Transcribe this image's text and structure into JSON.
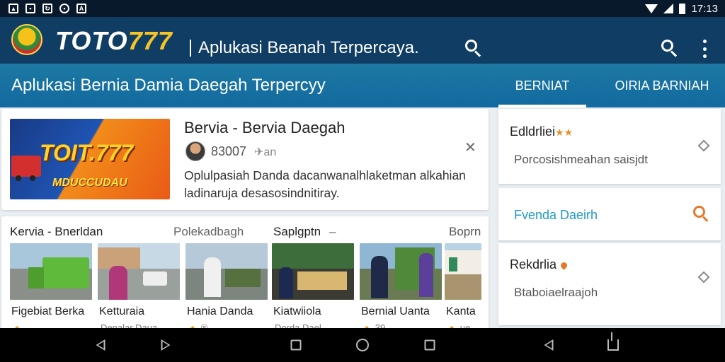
{
  "status_bar": {
    "time": "17:13",
    "left_icons": [
      "image-icon",
      "photo-icon",
      "sync-icon",
      "alarm-icon",
      "text-icon"
    ]
  },
  "app_bar": {
    "brand_prefix": "TOTO",
    "brand_number": "777",
    "subtitle": "Aplukasi Beanah Terpercaya."
  },
  "tab_bar": {
    "title": "Aplukasi Bernia Damia Daegah Terpercyy",
    "tabs": [
      {
        "label": "BERNIAT",
        "active": true
      },
      {
        "label": "OIRIA BARNIAH",
        "active": false
      }
    ]
  },
  "feature": {
    "banner_title": "TOIT.777",
    "banner_sub": "MDUCCUDAU",
    "title": "Bervia - Bervia Daegah",
    "meta": "83007",
    "meta_suffix": "✈an",
    "description": "Oplulpasiah Danda dacanwanalhlaketman alkahian ladinaruja desasosindnitiray."
  },
  "list": {
    "headers": [
      "Kervia - Bnerldan",
      "Polekadbagh",
      "Saplgptn",
      "Boprn"
    ],
    "dash": "–",
    "items": [
      {
        "caption": "Figebiat Berka",
        "sub": "🔸"
      },
      {
        "caption": "Ketturaia",
        "sub": "Denalar Daua"
      },
      {
        "caption": "Hania Danda",
        "sub": "🔸 ®"
      },
      {
        "caption": "Kiatwiiola",
        "sub": "Dorda Dael"
      },
      {
        "caption": "Bernial Uanta",
        "sub": "🔸 39"
      },
      {
        "caption": "Kanta",
        "sub": "🔸 ue"
      }
    ]
  },
  "side": {
    "card1": {
      "title": "Edldrliei",
      "stars": "★★",
      "sub": "Porcosishmeahan saisjdt"
    },
    "card2": {
      "label": "Fvenda Daeirh"
    },
    "card3": {
      "title": "Rekdrlia",
      "sub": "Btaboiaelraajoh"
    }
  },
  "colors": {
    "app_bar": "#103d63",
    "tab_bar": "#1d79a2",
    "accent_gold": "#f7c325",
    "accent_orange": "#e47a2e",
    "link_blue": "#1f9ac8"
  }
}
